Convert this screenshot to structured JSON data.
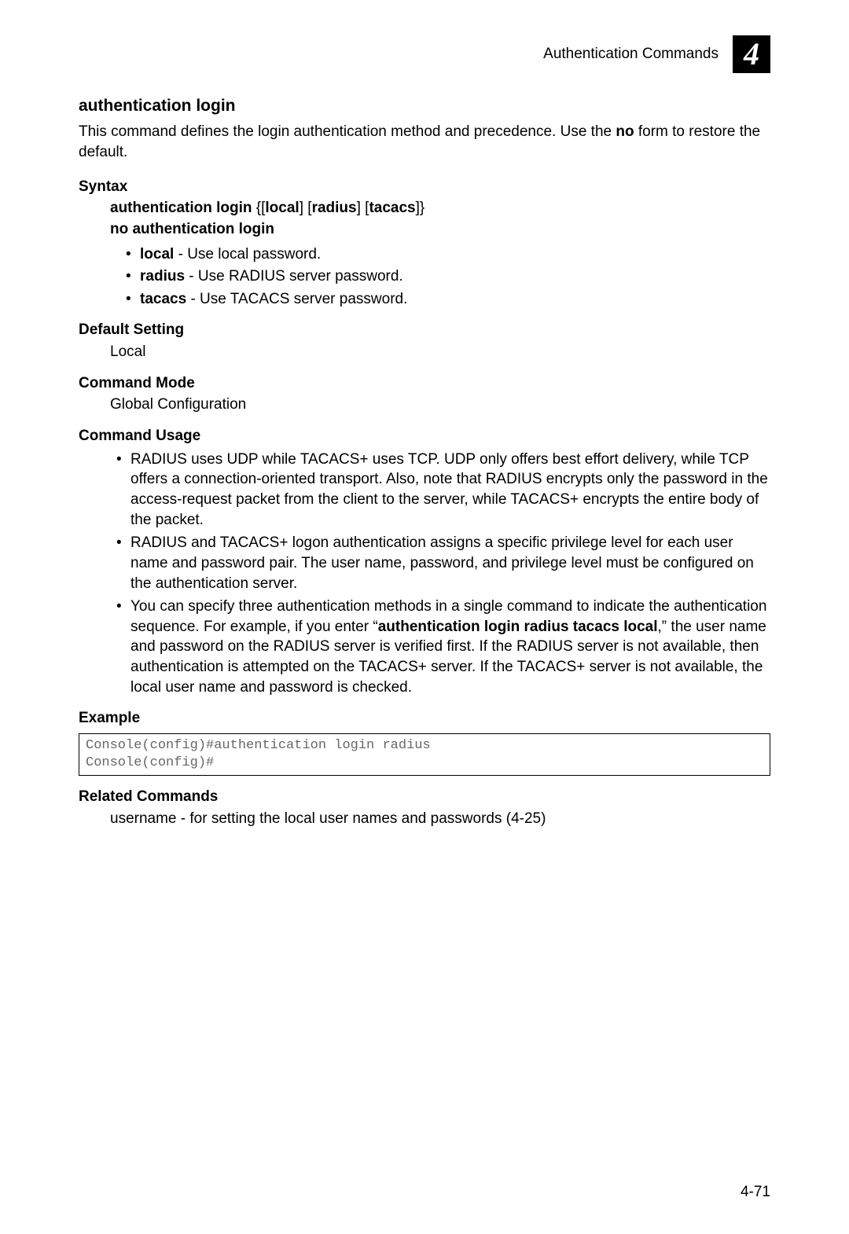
{
  "header": {
    "title": "Authentication Commands",
    "chapter_number": "4"
  },
  "section": {
    "title": "authentication login",
    "intro_pre": "This command defines the login authentication method and precedence. Use the ",
    "intro_bold": "no",
    "intro_post": " form to restore the default."
  },
  "syntax": {
    "heading": "Syntax",
    "line1_pre": "authentication login ",
    "line1_brace_open": "{[",
    "line1_local": "local",
    "line1_sep1": "] [",
    "line1_radius": "radius",
    "line1_sep2": "] [",
    "line1_tacacs": "tacacs",
    "line1_brace_close": "]}",
    "line2": "no authentication login",
    "opts": {
      "local_b": "local",
      "local_t": " - Use local password.",
      "radius_b": "radius",
      "radius_t": " - Use RADIUS server password.",
      "tacacs_b": "tacacs",
      "tacacs_t": " - Use TACACS server password."
    }
  },
  "default_setting": {
    "heading": "Default Setting",
    "value": "Local"
  },
  "command_mode": {
    "heading": "Command Mode",
    "value": "Global Configuration"
  },
  "command_usage": {
    "heading": "Command Usage",
    "items": {
      "u1": "RADIUS uses UDP while TACACS+ uses TCP. UDP only offers best effort delivery, while TCP offers a connection-oriented transport. Also, note that RADIUS encrypts only the password in the access-request packet from the client to the server, while TACACS+ encrypts the entire body of the packet.",
      "u2": "RADIUS and TACACS+ logon authentication assigns a specific privilege level for each user name and password pair. The user name, password, and privilege level must be configured on the authentication server.",
      "u3_pre": "You can specify three authentication methods in a single command to indicate the authentication sequence. For example, if you enter “",
      "u3_bold": "authentication login radius tacacs local",
      "u3_post": ",” the user name and password on the RADIUS server is verified first. If the RADIUS server is not available, then authentication is attempted on the TACACS+ server. If the TACACS+ server is not available, the local user name and password is checked."
    }
  },
  "example": {
    "heading": "Example",
    "code": "Console(config)#authentication login radius\nConsole(config)#"
  },
  "related": {
    "heading": "Related Commands",
    "value": "username - for setting the local user names and passwords (4-25)"
  },
  "page_number": "4-71"
}
